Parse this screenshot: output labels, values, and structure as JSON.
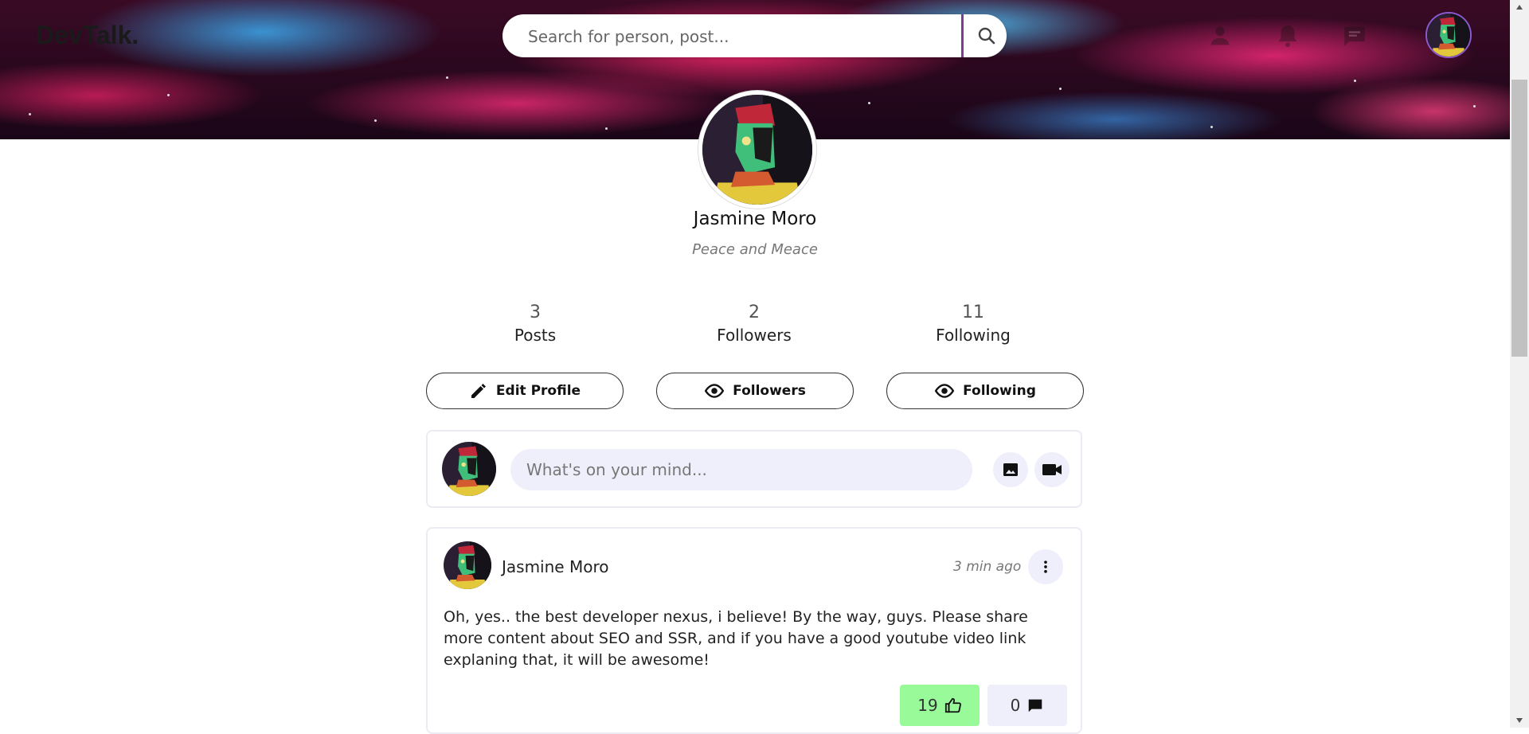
{
  "app": {
    "logo": "DevTalk."
  },
  "search": {
    "placeholder": "Search for person, post..."
  },
  "nav": {
    "icons": [
      "person-icon",
      "bell-icon",
      "chat-icon"
    ],
    "avatar_alt": "Jasmine Moro"
  },
  "profile": {
    "name": "Jasmine Moro",
    "bio": "Peace and Meace",
    "stats": [
      {
        "value": "3",
        "label": "Posts"
      },
      {
        "value": "2",
        "label": "Followers"
      },
      {
        "value": "11",
        "label": "Following"
      }
    ],
    "actions": [
      {
        "label": "Edit Profile",
        "icon": "pencil-icon"
      },
      {
        "label": "Followers",
        "icon": "eye-icon"
      },
      {
        "label": "Following",
        "icon": "eye-icon"
      }
    ]
  },
  "composer": {
    "placeholder": "What's on your mind...",
    "buttons": [
      "image-icon",
      "video-icon"
    ]
  },
  "post": {
    "author": "Jasmine Moro",
    "time": "3 min ago",
    "body": "Oh, yes.. the best developer nexus, i believe! By the way, guys. Please share more content about SEO and SSR, and if you have a good youtube video link explaning that, it will be awesome!",
    "likes": "19",
    "comments": "0"
  },
  "colors": {
    "like_bg": "#98fa98",
    "comment_bg": "#efeefb",
    "input_bg": "#efeefb",
    "search_divider": "#7a3b9a"
  }
}
